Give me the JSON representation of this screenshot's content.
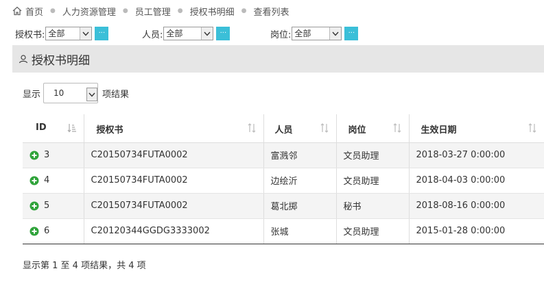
{
  "breadcrumb": [
    "首页",
    "人力资源管理",
    "员工管理",
    "授权书明细",
    "查看列表"
  ],
  "filters": [
    {
      "label": "授权书:",
      "value": "全部",
      "button": "..."
    },
    {
      "label": "人员:",
      "value": "全部",
      "button": "..."
    },
    {
      "label": "岗位:",
      "value": "全部",
      "button": "..."
    }
  ],
  "panel": {
    "title": "授权书明细"
  },
  "length": {
    "prefix": "显示",
    "value": "10",
    "suffix": "项结果"
  },
  "table": {
    "headers": [
      "ID",
      "授权书",
      "人员",
      "岗位",
      "生效日期"
    ],
    "rows": [
      [
        "3",
        "C20150734FUTA0002",
        "富溅邻",
        "文员助理",
        "2018-03-27 0:00:00"
      ],
      [
        "4",
        "C20150734FUTA0002",
        "边绘沂",
        "文员助理",
        "2018-04-03 0:00:00"
      ],
      [
        "5",
        "C20150734FUTA0002",
        "葛北掷",
        "秘书",
        "2018-08-16 0:00:00"
      ],
      [
        "6",
        "C20120344GGDG3333002",
        "张城",
        "文员助理",
        "2015-01-28 0:00:00"
      ]
    ]
  },
  "info": "显示第 1 至 4 项结果，共 4 项",
  "colors": {
    "accent": "#3bbfd8",
    "plus": "#2fa33a",
    "header_bg": "#e6e6e6"
  }
}
